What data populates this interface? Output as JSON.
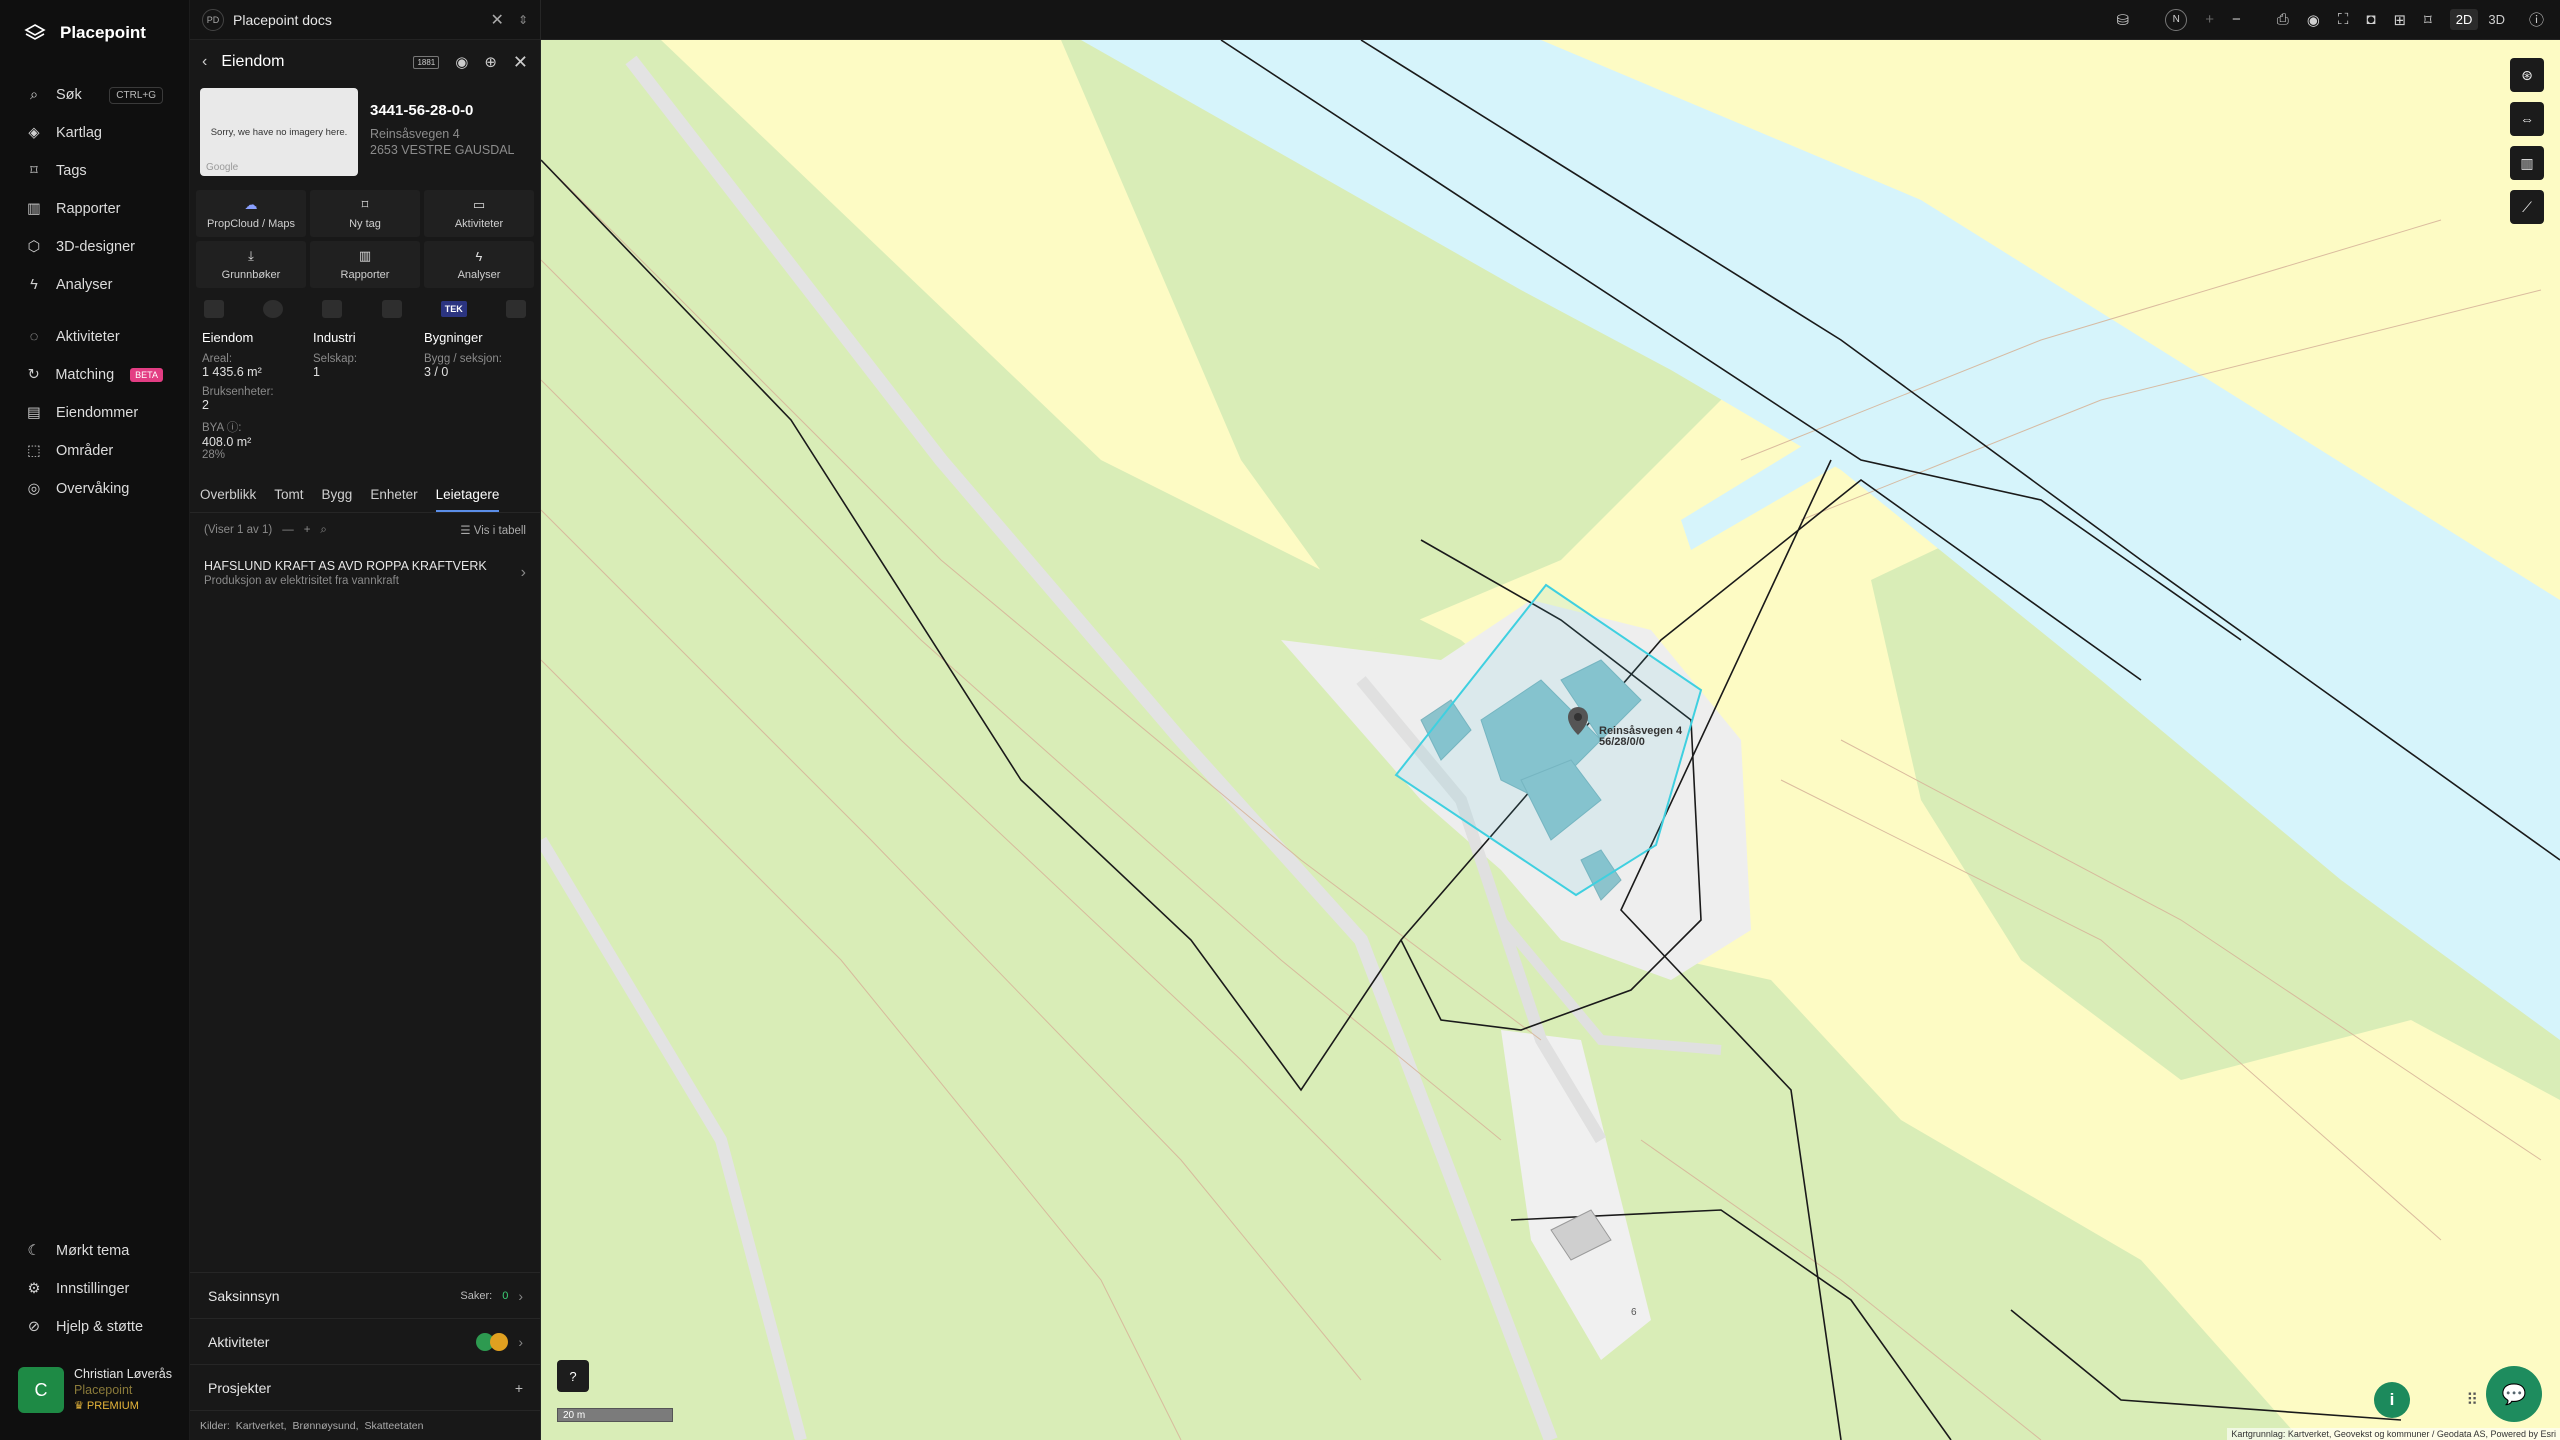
{
  "nav": {
    "brand": "Placepoint",
    "items": [
      {
        "label": "Søk",
        "icon": "search-icon",
        "shortcut": "CTRL+G"
      },
      {
        "label": "Kartlag",
        "icon": "layers-icon"
      },
      {
        "label": "Tags",
        "icon": "bookmark-icon"
      },
      {
        "label": "Rapporter",
        "icon": "chart-icon"
      },
      {
        "label": "3D-designer",
        "icon": "cube-icon"
      },
      {
        "label": "Analyser",
        "icon": "bolt-icon"
      },
      {
        "label": "Aktiviteter",
        "icon": "chat-icon"
      },
      {
        "label": "Matching",
        "icon": "refresh-icon",
        "badge": "BETA"
      },
      {
        "label": "Eiendommer",
        "icon": "document-icon"
      },
      {
        "label": "Områder",
        "icon": "area-icon"
      },
      {
        "label": "Overvåking",
        "icon": "watch-icon"
      }
    ],
    "bottom": [
      {
        "label": "Mørkt tema",
        "icon": "moon-icon"
      },
      {
        "label": "Innstillinger",
        "icon": "gear-icon"
      },
      {
        "label": "Hjelp & støtte",
        "icon": "help-icon"
      }
    ],
    "user": {
      "initial": "C",
      "name": "Christian Løverås",
      "org": "Placepoint",
      "plan": "PREMIUM"
    }
  },
  "panel": {
    "top_title": "Placepoint docs",
    "top_badge": "PD",
    "header": "Eiendom",
    "kv_badge": "1881",
    "property": {
      "id": "3441-56-28-0-0",
      "street": "Reinsåsvegen 4",
      "postal": "2653 VESTRE GAUSDAL",
      "thumb_text": "Sorry, we have no imagery here.",
      "thumb_credit": "Google"
    },
    "actions": [
      {
        "label": "PropCloud / Maps",
        "icon": "cloud-icon"
      },
      {
        "label": "Ny tag",
        "icon": "bookmark-icon"
      },
      {
        "label": "Aktiviteter",
        "icon": "chat-icon"
      },
      {
        "label": "Grunnbøker",
        "icon": "download-icon"
      },
      {
        "label": "Rapporter",
        "icon": "chart-icon"
      },
      {
        "label": "Analyser",
        "icon": "bolt-icon"
      }
    ],
    "source_tek": "TEK",
    "stats": {
      "col1_title": "Eiendom",
      "areal_label": "Areal:",
      "areal_value": "1 435.6 m²",
      "bruks_label": "Bruksenheter:",
      "bruks_value": "2",
      "bya_label": "BYA ⓘ:",
      "bya_value": "408.0 m²",
      "bya_pct": "28%",
      "col2_title": "Industri",
      "selskap_label": "Selskap:",
      "selskap_value": "1",
      "col3_title": "Bygninger",
      "bygg_label": "Bygg / seksjon:",
      "bygg_value": "3 / 0"
    },
    "tabs": [
      "Overblikk",
      "Tomt",
      "Bygg",
      "Enheter",
      "Leietagere"
    ],
    "active_tab": "Leietagere",
    "list_info": "(Viser 1 av 1)",
    "table_link": "Vis i tabell",
    "tenant": {
      "name": "HAFSLUND KRAFT AS AVD ROPPA KRAFTVERK",
      "desc": "Produksjon av elektrisitet fra vannkraft"
    },
    "footer": {
      "saksinnsyn": "Saksinnsyn",
      "saker_label": "Saker:",
      "saker_value": "0",
      "aktiviteter": "Aktiviteter",
      "prosjekter": "Prosjekter",
      "sources_label": "Kilder:",
      "sources": [
        "Kartverket,",
        "Brønnøysund,",
        "Skatteetaten"
      ]
    }
  },
  "topbar": {
    "compass": "N",
    "mode_2d": "2D",
    "mode_3d": "3D"
  },
  "map": {
    "address_label": "Reinsåsvegen 4",
    "address_id": "56/28/0/0",
    "house_number": "6",
    "scale": "20 m",
    "help": "?",
    "info": "i",
    "attribution": "Kartgrunnlag: Kartverket, Geovekst og kommuner / Geodata AS, Powered by Esri"
  },
  "colors": {
    "accent": "#5b8ee8",
    "green": "#1e8c5e",
    "beta": "#e33d83",
    "water": "#d6f4fb",
    "forest": "#d9edb7",
    "field": "#fdfbc4"
  }
}
